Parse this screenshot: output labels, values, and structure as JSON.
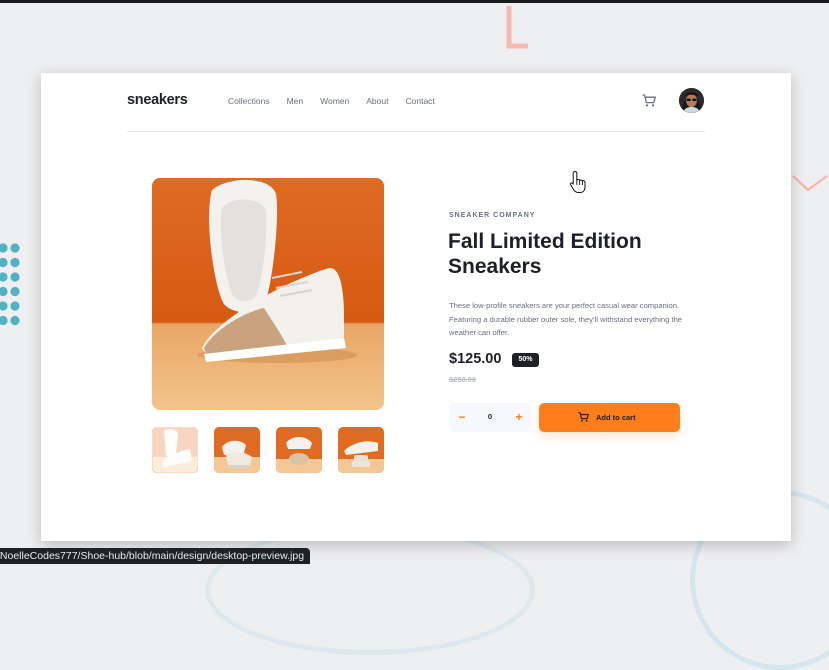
{
  "header": {
    "logo": "sneakers",
    "nav": [
      "Collections",
      "Men",
      "Women",
      "About",
      "Contact"
    ]
  },
  "product": {
    "company": "SNEAKER COMPANY",
    "title": "Fall Limited Edition Sneakers",
    "description": "These low-profile sneakers are your perfect casual wear companion. Featuring a durable rubber outer sole, they’ll withstand everything the weather can offer.",
    "price": "$125.00",
    "discount": "50%",
    "original_price": "$250.00"
  },
  "cart_controls": {
    "minus": "−",
    "quantity": "0",
    "plus": "+",
    "add_label": "Add to cart"
  },
  "gallery": {
    "thumbnail_count": 4,
    "active_thumbnail": 1
  },
  "browser": {
    "status_url": "/NoelleCodes777/Shoe-hub/blob/main/design/desktop-preview.jpg"
  },
  "colors": {
    "accent": "#ff7e1b",
    "dark": "#1d2026",
    "text_muted": "#69707d",
    "background": "#eeeff1",
    "dot_accent": "#53b1c4"
  },
  "icons": [
    "cart-icon",
    "avatar",
    "pointer-cursor-icon"
  ]
}
